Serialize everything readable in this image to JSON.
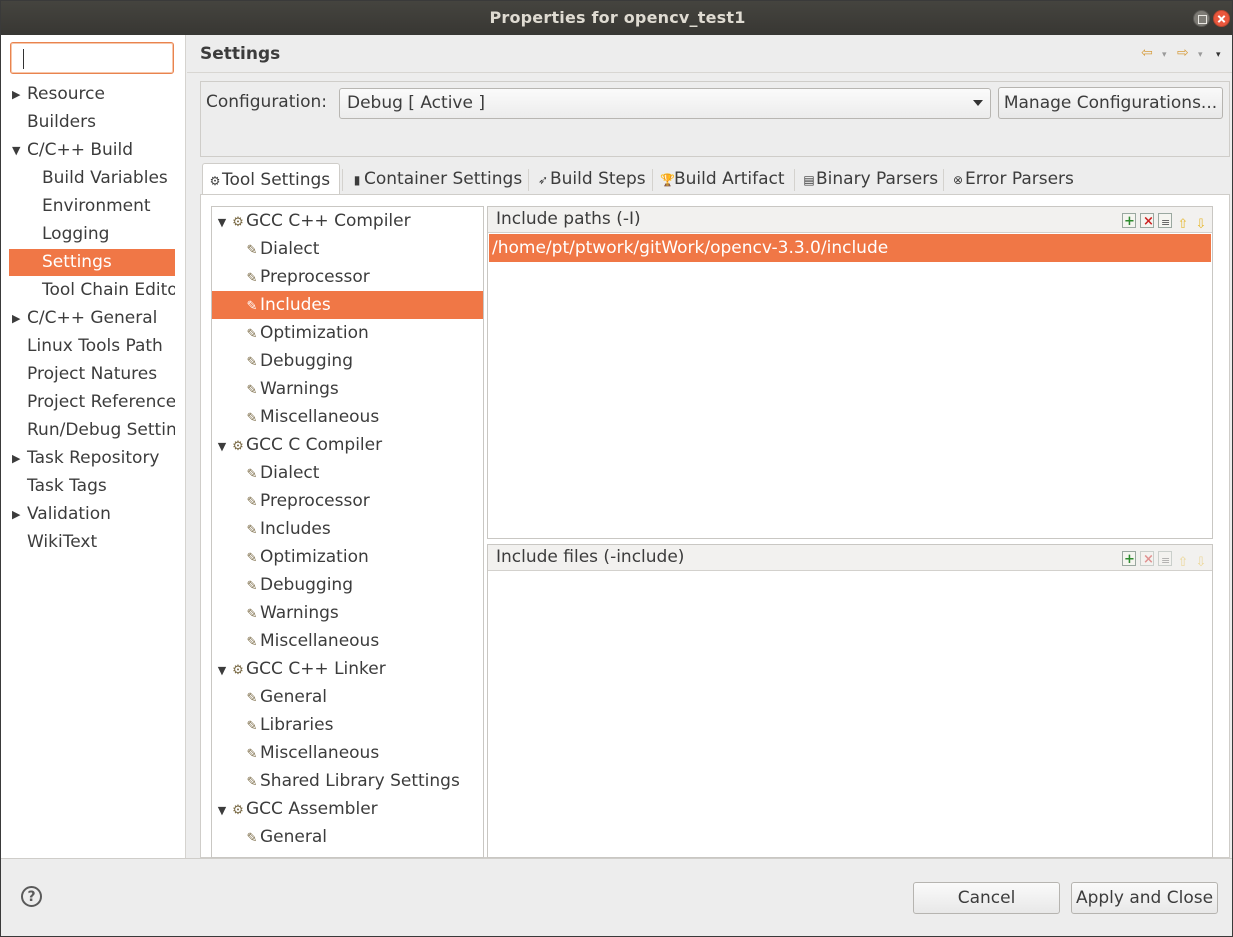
{
  "window": {
    "title": "Properties for opencv_test1"
  },
  "nav": {
    "filter_value": "",
    "items": [
      {
        "label": "Resource",
        "expander": "▶"
      },
      {
        "label": "Builders",
        "expander": ""
      },
      {
        "label": "C/C++ Build",
        "expander": "▼"
      },
      {
        "label": "Build Variables",
        "expander": ""
      },
      {
        "label": "Environment",
        "expander": ""
      },
      {
        "label": "Logging",
        "expander": ""
      },
      {
        "label": "Settings",
        "expander": ""
      },
      {
        "label": "Tool Chain Edito",
        "expander": ""
      },
      {
        "label": "C/C++ General",
        "expander": "▶"
      },
      {
        "label": "Linux Tools Path",
        "expander": ""
      },
      {
        "label": "Project Natures",
        "expander": ""
      },
      {
        "label": "Project Reference",
        "expander": ""
      },
      {
        "label": "Run/Debug Settin",
        "expander": ""
      },
      {
        "label": "Task Repository",
        "expander": "▶"
      },
      {
        "label": "Task Tags",
        "expander": ""
      },
      {
        "label": "Validation",
        "expander": "▶"
      },
      {
        "label": "WikiText",
        "expander": ""
      }
    ]
  },
  "page": {
    "title": "Settings",
    "back_icon": "⇦",
    "forward_icon": "⇨",
    "menu_icon": "▾"
  },
  "config": {
    "label": "Configuration:",
    "value": "Debug  [ Active ]",
    "manage_label": "Manage Configurations..."
  },
  "tabs": [
    {
      "label": "Tool Settings",
      "icon": "⚙"
    },
    {
      "label": "Container Settings",
      "icon": "▮"
    },
    {
      "label": "Build Steps",
      "icon": "➶"
    },
    {
      "label": "Build Artifact",
      "icon": "🏆"
    },
    {
      "label": "Binary Parsers",
      "icon": "▤"
    },
    {
      "label": "Error Parsers",
      "icon": "⊗"
    }
  ],
  "tool_tree": [
    {
      "label": "GCC C++ Compiler",
      "kind": "tool",
      "icon": "⚙"
    },
    {
      "label": "Dialect",
      "kind": "option",
      "icon": "✎"
    },
    {
      "label": "Preprocessor",
      "kind": "option",
      "icon": "✎"
    },
    {
      "label": "Includes",
      "kind": "option",
      "icon": "✎"
    },
    {
      "label": "Optimization",
      "kind": "option",
      "icon": "✎"
    },
    {
      "label": "Debugging",
      "kind": "option",
      "icon": "✎"
    },
    {
      "label": "Warnings",
      "kind": "option",
      "icon": "✎"
    },
    {
      "label": "Miscellaneous",
      "kind": "option",
      "icon": "✎"
    },
    {
      "label": "GCC C Compiler",
      "kind": "tool",
      "icon": "⚙"
    },
    {
      "label": "Dialect",
      "kind": "option",
      "icon": "✎"
    },
    {
      "label": "Preprocessor",
      "kind": "option",
      "icon": "✎"
    },
    {
      "label": "Includes",
      "kind": "option",
      "icon": "✎"
    },
    {
      "label": "Optimization",
      "kind": "option",
      "icon": "✎"
    },
    {
      "label": "Debugging",
      "kind": "option",
      "icon": "✎"
    },
    {
      "label": "Warnings",
      "kind": "option",
      "icon": "✎"
    },
    {
      "label": "Miscellaneous",
      "kind": "option",
      "icon": "✎"
    },
    {
      "label": "GCC C++ Linker",
      "kind": "tool",
      "icon": "⚙"
    },
    {
      "label": "General",
      "kind": "option",
      "icon": "✎"
    },
    {
      "label": "Libraries",
      "kind": "option",
      "icon": "✎"
    },
    {
      "label": "Miscellaneous",
      "kind": "option",
      "icon": "✎"
    },
    {
      "label": "Shared Library Settings",
      "kind": "option",
      "icon": "✎"
    },
    {
      "label": "GCC Assembler",
      "kind": "tool",
      "icon": "⚙"
    },
    {
      "label": "General",
      "kind": "option",
      "icon": "✎"
    }
  ],
  "include_paths": {
    "title": "Include paths (-I)",
    "rows": [
      "/home/pt/ptwork/gitWork/opencv-3.3.0/include"
    ],
    "tools": [
      "add",
      "delete",
      "edit",
      "move-up",
      "move-down"
    ]
  },
  "include_files": {
    "title": "Include files (-include)",
    "rows": [],
    "tools": [
      "add",
      "delete",
      "edit",
      "move-up",
      "move-down"
    ]
  },
  "footer": {
    "help_label": "?",
    "cancel_label": "Cancel",
    "apply_label": "Apply and Close"
  }
}
